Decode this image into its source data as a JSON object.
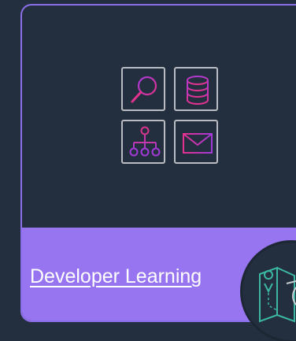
{
  "card": {
    "title": "Developer Learning",
    "icons": [
      "search-icon",
      "database-icon",
      "hierarchy-icon",
      "mail-icon"
    ],
    "badge_icon": "map-location-icon"
  },
  "colors": {
    "background": "#232f3e",
    "card_border": "#8b6fe8",
    "footer": "#9775f0",
    "icon_pink": "#e5318f",
    "icon_purple": "#a23ad8",
    "tile_border": "#b9bcc2",
    "badge_teal": "#3bb7a4"
  }
}
